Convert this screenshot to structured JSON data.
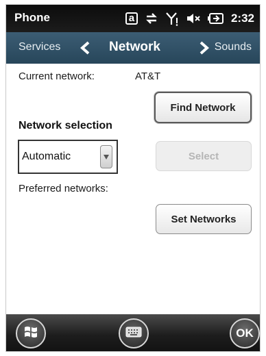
{
  "statusbar": {
    "title": "Phone",
    "time": "2:32",
    "icons": [
      "sim-a-icon",
      "data-connection-icon",
      "signal-icon",
      "volume-muted-icon",
      "battery-charging-icon"
    ],
    "sim_label": "a"
  },
  "nav": {
    "prev": "Services",
    "current": "Network",
    "next": "Sounds"
  },
  "network": {
    "current_label": "Current network:",
    "current_value": "AT&T",
    "selection_heading": "Network selection",
    "selection_value": "Automatic",
    "preferred_label": "Preferred networks:"
  },
  "buttons": {
    "find": "Find Network",
    "select": "Select",
    "set": "Set Networks"
  },
  "softkeys": {
    "ok": "OK"
  },
  "colors": {
    "nav_bar": "#2f4f63",
    "status_bar": "#111111",
    "disabled_text": "#b5b5b5"
  }
}
